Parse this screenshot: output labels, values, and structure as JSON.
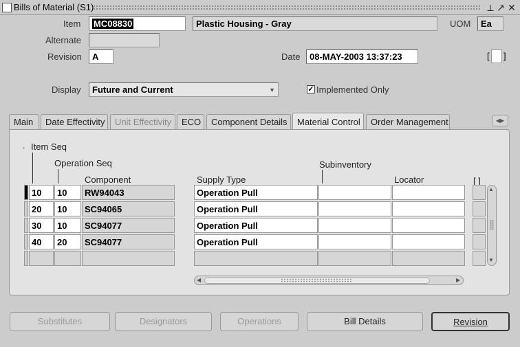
{
  "window": {
    "title": "Bills of Material (S1)",
    "icon_label": "ORACLE",
    "controls": [
      "⟂",
      "↗",
      "✕"
    ]
  },
  "header": {
    "item_label": "Item",
    "item_value": "MC08830",
    "item_description": "Plastic Housing - Gray",
    "uom_label": "UOM",
    "uom_value": "Ea",
    "alternate_label": "Alternate",
    "alternate_value": "",
    "revision_label": "Revision",
    "revision_value": "A",
    "date_label": "Date",
    "date_value": "08-MAY-2003 13:37:23",
    "flex_field": "[ ]",
    "display_label": "Display",
    "display_value": "Future and Current",
    "implemented_only_label": "Implemented Only",
    "implemented_only_checked": true
  },
  "tabs": [
    {
      "label": "Main",
      "state": "normal"
    },
    {
      "label": "Date Effectivity",
      "state": "normal"
    },
    {
      "label": "Unit Effectivity",
      "state": "disabled"
    },
    {
      "label": "ECO",
      "state": "normal"
    },
    {
      "label": "Component Details",
      "state": "normal"
    },
    {
      "label": "Material Control",
      "state": "active"
    },
    {
      "label": "Order Management",
      "state": "normal"
    }
  ],
  "table": {
    "columns": {
      "item_seq": "Item Seq",
      "operation_seq": "Operation Seq",
      "component": "Component",
      "supply_type": "Supply Type",
      "subinventory": "Subinventory",
      "locator": "Locator",
      "flex": "[ ]"
    },
    "rows": [
      {
        "item_seq": "10",
        "operation_seq": "10",
        "component": "RW94043",
        "supply_type": "Operation Pull",
        "subinventory": "",
        "locator": ""
      },
      {
        "item_seq": "20",
        "operation_seq": "10",
        "component": "SC94065",
        "supply_type": "Operation Pull",
        "subinventory": "",
        "locator": ""
      },
      {
        "item_seq": "30",
        "operation_seq": "10",
        "component": "SC94077",
        "supply_type": "Operation Pull",
        "subinventory": "",
        "locator": ""
      },
      {
        "item_seq": "40",
        "operation_seq": "20",
        "component": "SC94077",
        "supply_type": "Operation Pull",
        "subinventory": "",
        "locator": ""
      },
      {
        "item_seq": "",
        "operation_seq": "",
        "component": "",
        "supply_type": "",
        "subinventory": "",
        "locator": ""
      }
    ]
  },
  "buttons": {
    "substitutes": "Substitutes",
    "designators": "Designators",
    "operations": "Operations",
    "bill_details": "Bill Details",
    "revision": "Revision"
  }
}
